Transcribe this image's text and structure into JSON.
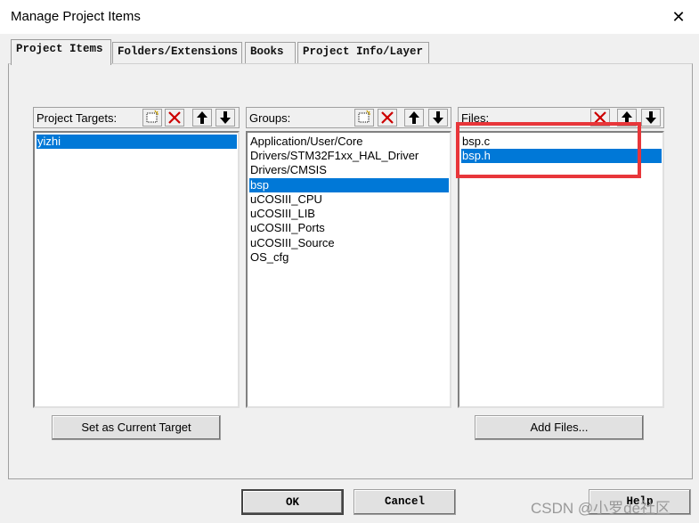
{
  "window": {
    "title": "Manage Project Items",
    "close_glyph": "✕"
  },
  "tabs": [
    "Project Items",
    "Folders/Extensions",
    "Books",
    "Project Info/Layer"
  ],
  "targets": {
    "label": "Project Targets:",
    "items": [
      "yizhi"
    ]
  },
  "groups": {
    "label": "Groups:",
    "items": [
      "Application/User/Core",
      "Drivers/STM32F1xx_HAL_Driver",
      "Drivers/CMSIS",
      "bsp",
      "uCOSIII_CPU",
      "uCOSIII_LIB",
      "uCOSIII_Ports",
      "uCOSIII_Source",
      "OS_cfg"
    ]
  },
  "files": {
    "label": "Files:",
    "items": [
      "bsp.c",
      "bsp.h"
    ]
  },
  "buttons": {
    "set_target": "Set as Current Target",
    "add_files": "Add Files...",
    "ok": "OK",
    "cancel": "Cancel",
    "help": "Help"
  },
  "watermark": "CSDN @小罗de社区",
  "colors": {
    "selection": "#0078d7",
    "highlight_box": "#e8363a"
  },
  "icons": [
    "new-item-icon",
    "delete-icon",
    "move-up-icon",
    "move-down-icon"
  ]
}
